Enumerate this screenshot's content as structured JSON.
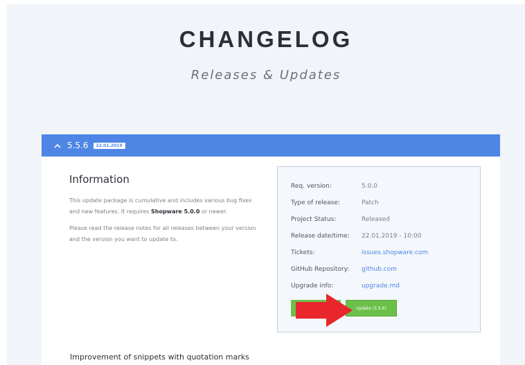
{
  "header": {
    "title": "CHANGELOG",
    "subtitle": "Releases & Updates"
  },
  "release": {
    "version": "5.5.6",
    "date_badge": "22.01.2019",
    "collapse_icon": "caret-up-icon",
    "bar_color": "#4f86e6"
  },
  "information": {
    "heading": "Information",
    "p1_start": "This update package is cumulative and includes various bug fixes and new features. It requires ",
    "p1_bold": "Shopware 5.0.0",
    "p1_end": " or newer.",
    "p2": "Please read the release notes for all releases between your version and the version you want to update to."
  },
  "details": {
    "rows": [
      {
        "key": "Req. version:",
        "value": "5.0.0"
      },
      {
        "key": "Type of release:",
        "value": "Patch"
      },
      {
        "key": "Project Status:",
        "value": "Released"
      },
      {
        "key": "Release date/time:",
        "value": "22.01.2019 - 10:00"
      },
      {
        "key": "Tickets:",
        "value": "issues.shopware.com"
      },
      {
        "key": "GitHub Repository:",
        "value": "github.com"
      },
      {
        "key": "Upgrade info:",
        "value": "upgrade.md"
      }
    ],
    "update_button": "Update (5.5.6)",
    "button_color": "#6cc04a",
    "link_color": "#4f86e6"
  },
  "annotation": {
    "arrow_icon": "red-arrow-icon",
    "color": "#e8262c"
  },
  "section": {
    "next_heading": "Improvement of snippets with quotation marks"
  }
}
